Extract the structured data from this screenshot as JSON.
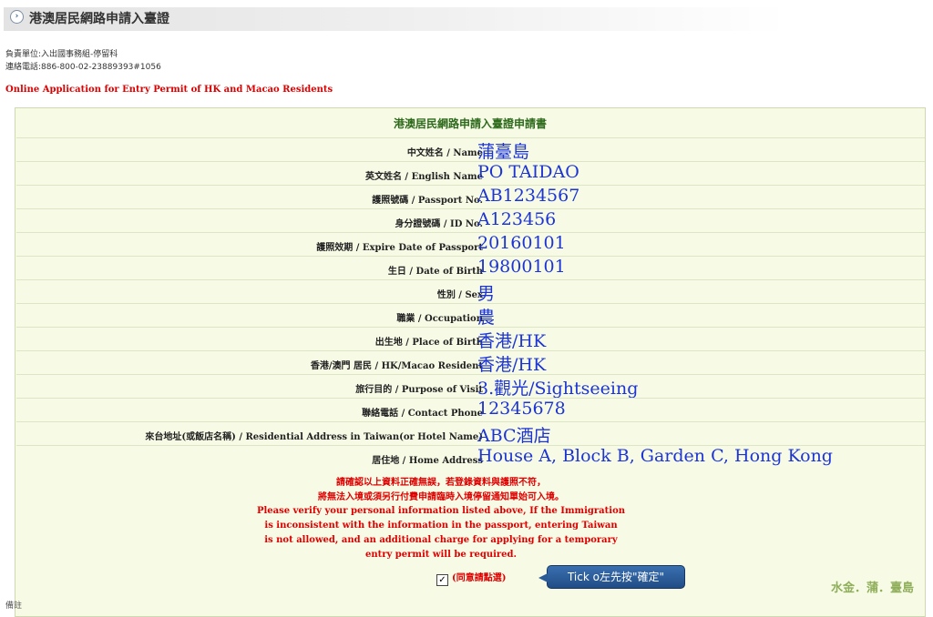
{
  "header": {
    "title": "港澳居民網路申請入臺證",
    "icon": "chevron-circle-icon"
  },
  "contact": {
    "unit": "負責單位:入出國事務組-停留科",
    "phone": "連絡電話:886-800-02-23889393#1056"
  },
  "notice": "Online Application for Entry Permit of HK and Macao Residents",
  "form": {
    "title": "港澳居民網路申請入臺證申請書",
    "rows": [
      {
        "label": "中文姓名 / Name",
        "value": "蒲臺島"
      },
      {
        "label": "英文姓名 / English Name",
        "value": "PO TAIDAO"
      },
      {
        "label": "護照號碼 / Passport No.",
        "value": "AB1234567"
      },
      {
        "label": "身分證號碼 / ID No.",
        "value": "A123456"
      },
      {
        "label": "護照效期 / Expire Date of Passport",
        "value": "20160101"
      },
      {
        "label": "生日 / Date of Birth",
        "value": "19800101"
      },
      {
        "label": "性別 / Sex",
        "value": "男"
      },
      {
        "label": "職業 / Occupation",
        "value": "農"
      },
      {
        "label": "出生地 / Place of Birth",
        "value": "香港/HK"
      },
      {
        "label": "香港/澳門 居民 / HK/Macao Resident",
        "value": "香港/HK"
      },
      {
        "label": "旅行目的 / Purpose of Visit",
        "value": "3.觀光/Sightseeing"
      },
      {
        "label": "聯絡電話 / Contact Phone",
        "value": "12345678"
      },
      {
        "label": "來台地址(或飯店名稱) / Residential Address in Taiwan(or Hotel Name)",
        "value": "ABC酒店"
      },
      {
        "label": "居住地 / Home Address",
        "value": "House A, Block B, Garden C, Hong Kong"
      }
    ],
    "warning": [
      "請確認以上資料正確無誤，若登錄資料與護照不符，",
      "將無法入境或須另行付費申請臨時入境停留通知單始可入境。",
      "Please verify your personal information listed above, If the Immigration",
      "is inconsistent with the information in the passport, entering Taiwan",
      "is not allowed, and an additional charge for applying for a temporary",
      "entry permit will be required."
    ],
    "agree_label": "(同意請點選)",
    "agree_checked": true
  },
  "tooltip": "Tick o左先按\"確定\"",
  "watermark": "水金．蒲．臺島",
  "bottom_text": "備註"
}
